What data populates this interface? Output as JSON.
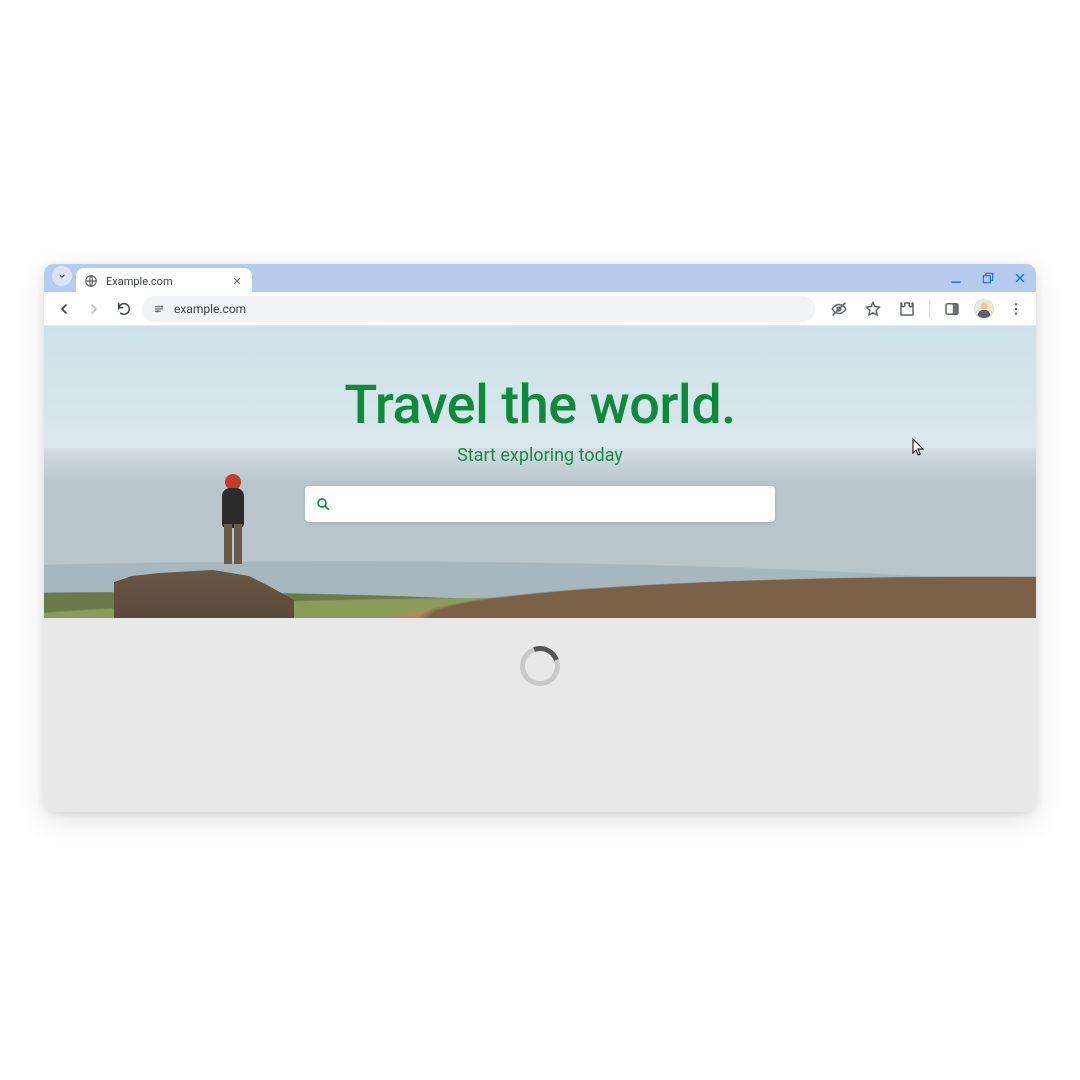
{
  "browser": {
    "tab": {
      "title": "Example.com",
      "favicon": "globe-icon"
    },
    "url": "example.com",
    "controls": {
      "minimize": "minimize-icon",
      "restore": "restore-icon",
      "close": "close-icon"
    }
  },
  "page": {
    "hero": {
      "title": "Travel the world.",
      "subtitle": "Start exploring today",
      "search_placeholder": ""
    },
    "loading": true
  },
  "colors": {
    "accent_green": "#0f8a3c",
    "tabstrip": "#b6cbed"
  }
}
